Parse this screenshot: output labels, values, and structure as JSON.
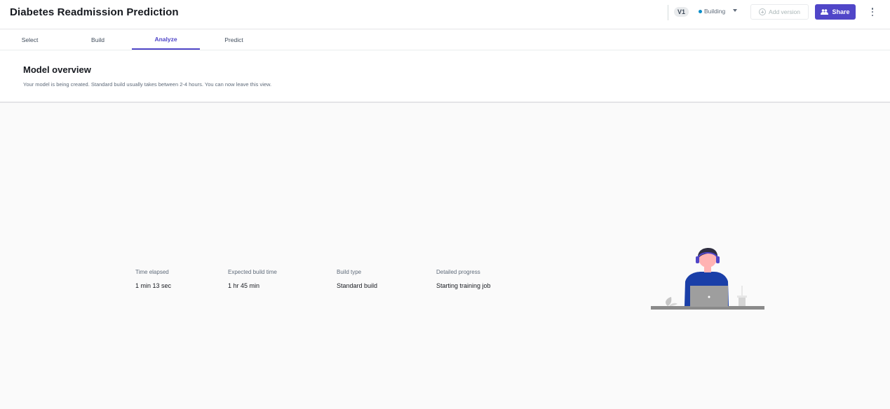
{
  "header": {
    "title": "Diabetes Readmission Prediction",
    "version": "V1",
    "status": "Building",
    "add_version_label": "Add version",
    "share_label": "Share",
    "more_icon": "more-vertical-icon",
    "colors": {
      "accent": "#5046c8",
      "status_dot": "#0a8ec9"
    }
  },
  "tabs": [
    {
      "label": "Select"
    },
    {
      "label": "Build"
    },
    {
      "label": "Analyze",
      "active": true
    },
    {
      "label": "Predict"
    }
  ],
  "overview": {
    "title": "Model overview",
    "subtitle": "Your model is being created. Standard build usually takes between 2-4 hours. You can now leave this view."
  },
  "stats": [
    {
      "label": "Time elapsed",
      "value": "1 min 13 sec"
    },
    {
      "label": "Expected build time",
      "value": "1 hr 45 min"
    },
    {
      "label": "Build type",
      "value": "Standard build"
    },
    {
      "label": "Detailed progress",
      "value": "Starting training job"
    }
  ]
}
